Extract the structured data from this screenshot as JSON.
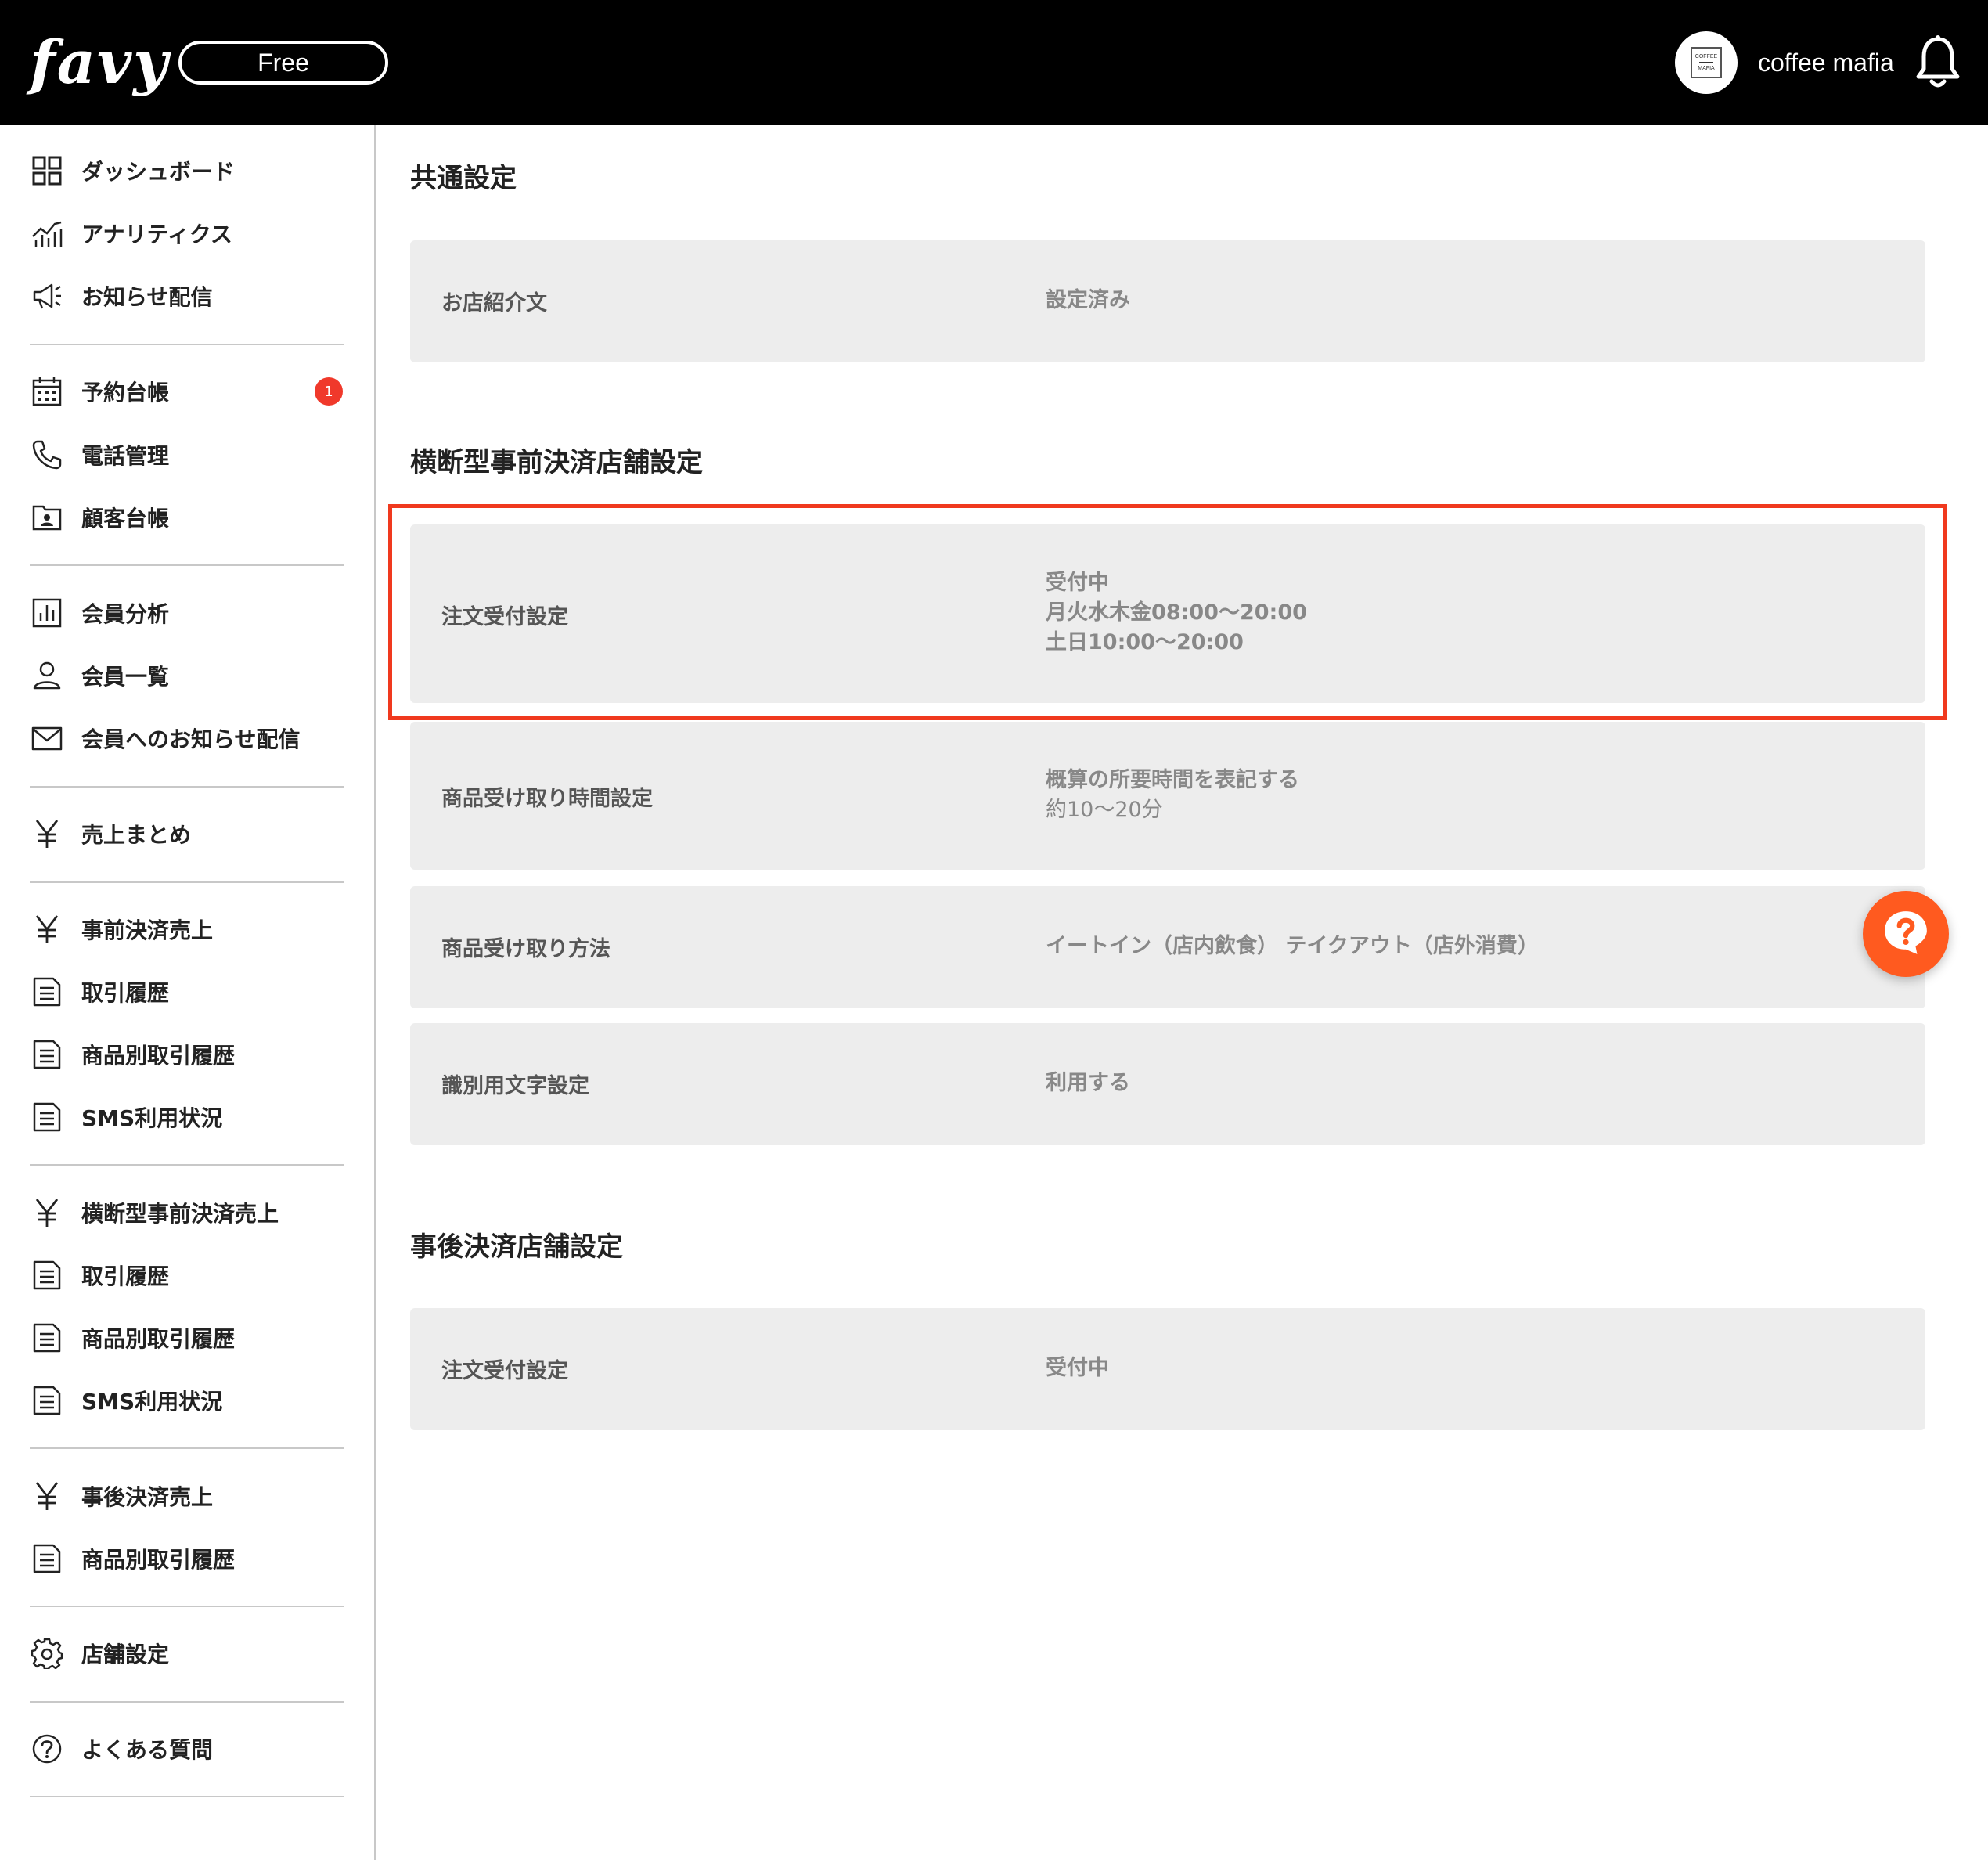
{
  "header": {
    "logo": "favy",
    "plan": "Free",
    "avatar_line1": "COFFEE",
    "avatar_line2": "MAFIA",
    "account_name": "coffee mafia"
  },
  "sidebar": {
    "items": [
      {
        "label": "ダッシュボード",
        "icon": "grid-icon"
      },
      {
        "label": "アナリティクス",
        "icon": "analytics-chart-icon"
      },
      {
        "label": "お知らせ配信",
        "icon": "megaphone-icon"
      },
      {
        "label": "予約台帳",
        "icon": "calendar-icon",
        "badge": "1"
      },
      {
        "label": "電話管理",
        "icon": "phone-icon"
      },
      {
        "label": "顧客台帳",
        "icon": "customer-folder-icon"
      },
      {
        "label": "会員分析",
        "icon": "bar-chart-icon"
      },
      {
        "label": "会員一覧",
        "icon": "person-icon"
      },
      {
        "label": "会員へのお知らせ配信",
        "icon": "mail-icon"
      },
      {
        "label": "売上まとめ",
        "icon": "yen-icon"
      },
      {
        "label": "事前決済売上",
        "icon": "yen-icon"
      },
      {
        "label": "取引履歴",
        "icon": "document-icon"
      },
      {
        "label": "商品別取引履歴",
        "icon": "document-icon"
      },
      {
        "label": "SMS利用状況",
        "icon": "document-icon"
      },
      {
        "label": "横断型事前決済売上",
        "icon": "yen-icon"
      },
      {
        "label": "取引履歴",
        "icon": "document-icon"
      },
      {
        "label": "商品別取引履歴",
        "icon": "document-icon"
      },
      {
        "label": "SMS利用状況",
        "icon": "document-icon"
      },
      {
        "label": "事後決済売上",
        "icon": "yen-icon"
      },
      {
        "label": "商品別取引履歴",
        "icon": "document-icon"
      },
      {
        "label": "店舗設定",
        "icon": "gear-icon"
      },
      {
        "label": "よくある質問",
        "icon": "question-circle-icon"
      }
    ]
  },
  "main": {
    "common": {
      "title": "共通設定",
      "rows": [
        {
          "label": "お店紹介文",
          "value": "設定済み"
        }
      ]
    },
    "cross": {
      "title": "横断型事前決済店舗設定",
      "rows": [
        {
          "label": "注文受付設定",
          "value_lines": [
            "受付中",
            "月火水木金08:00〜20:00",
            "土日10:00〜20:00"
          ]
        },
        {
          "label": "商品受け取り時間設定",
          "value_lines": [
            "概算の所要時間を表記する",
            "約10〜20分"
          ]
        },
        {
          "label": "商品受け取り方法",
          "value": "イートイン（店内飲食） テイクアウト（店外消費）"
        },
        {
          "label": "識別用文字設定",
          "value": "利用する"
        }
      ]
    },
    "post": {
      "title": "事後決済店舗設定",
      "rows": [
        {
          "label": "注文受付設定",
          "value": "受付中"
        }
      ]
    }
  },
  "help": {
    "icon": "help-bubble-icon"
  },
  "colors": {
    "header_bg": "#000000",
    "row_bg": "#ededed",
    "highlight": "#f0391e",
    "badge": "#f0392b",
    "help_button": "#ff5a1f"
  }
}
